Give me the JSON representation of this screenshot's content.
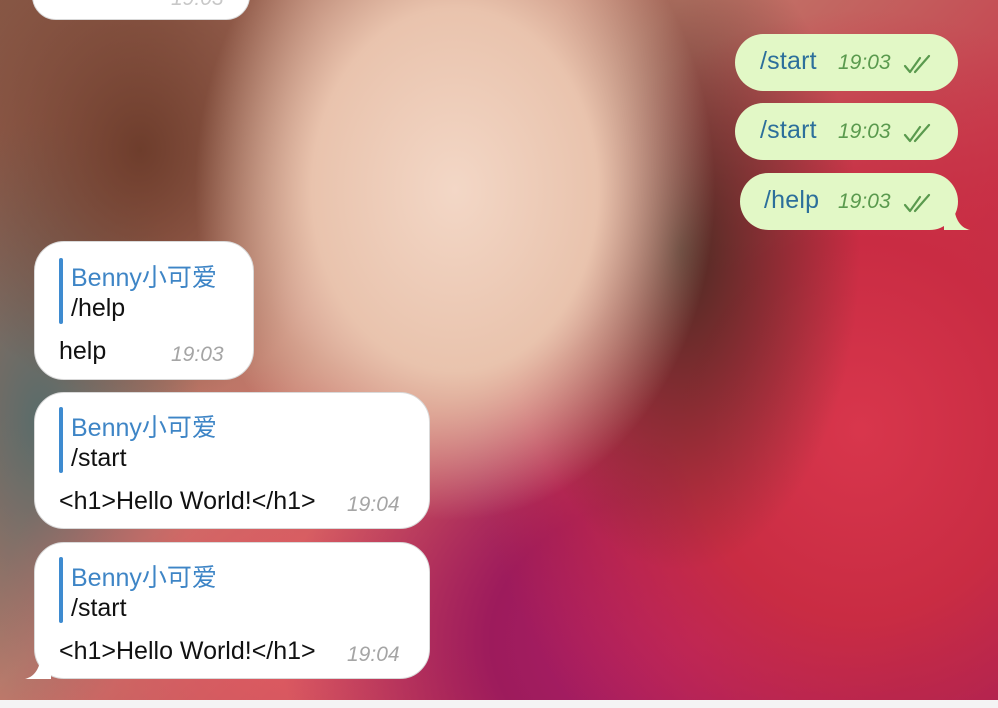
{
  "top_partial": {
    "time": "19:03"
  },
  "outgoing": [
    {
      "text": "/start",
      "time": "19:03",
      "status_icon": "double-check-icon"
    },
    {
      "text": "/start",
      "time": "19:03",
      "status_icon": "double-check-icon"
    },
    {
      "text": "/help",
      "time": "19:03",
      "status_icon": "double-check-icon"
    }
  ],
  "incoming": [
    {
      "reply_name": "Benny小可爱",
      "reply_text": "/help",
      "text": "help",
      "time": "19:03"
    },
    {
      "reply_name": "Benny小可爱",
      "reply_text": "/start",
      "text": "<h1>Hello World!</h1>",
      "time": "19:04"
    },
    {
      "reply_name": "Benny小可爱",
      "reply_text": "/start",
      "text": "<h1>Hello World!</h1>",
      "time": "19:04"
    }
  ],
  "colors": {
    "outgoing_bubble": "#e2f8c6",
    "outgoing_text": "#2c6f9b",
    "outgoing_time": "#5a9a4e",
    "incoming_bubble": "#ffffff",
    "reply_accent": "#3e8bd0",
    "incoming_time": "#a5a5a5"
  }
}
